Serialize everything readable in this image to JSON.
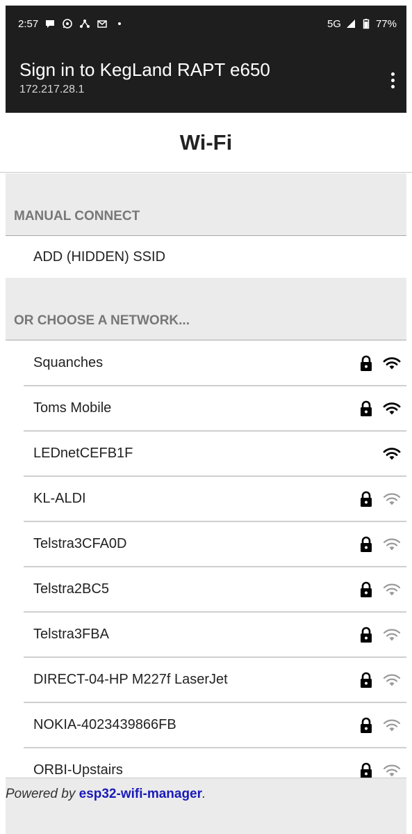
{
  "status_bar": {
    "time": "2:57",
    "left_icons": [
      "chat-bubble-icon",
      "whatsapp-icon",
      "network-share-icon",
      "gmail-icon",
      "dot-icon"
    ],
    "network_type": "5G",
    "battery": "77%"
  },
  "app_bar": {
    "title": "Sign in to KegLand RAPT e650",
    "subtitle": "172.217.28.1"
  },
  "page": {
    "heading": "Wi-Fi"
  },
  "manual_connect": {
    "header": "MANUAL CONNECT",
    "hidden_ssid_label": "ADD (HIDDEN) SSID"
  },
  "networks": {
    "header": "OR CHOOSE A NETWORK...",
    "items": [
      {
        "ssid": "Squanches",
        "locked": true,
        "signal": "strong"
      },
      {
        "ssid": "Toms Mobile",
        "locked": true,
        "signal": "strong"
      },
      {
        "ssid": "LEDnetCEFB1F",
        "locked": false,
        "signal": "strong"
      },
      {
        "ssid": "KL-ALDI",
        "locked": true,
        "signal": "weak"
      },
      {
        "ssid": "Telstra3CFA0D",
        "locked": true,
        "signal": "weak"
      },
      {
        "ssid": "Telstra2BC5",
        "locked": true,
        "signal": "weak"
      },
      {
        "ssid": "Telstra3FBA",
        "locked": true,
        "signal": "weak"
      },
      {
        "ssid": "DIRECT-04-HP M227f LaserJet",
        "locked": true,
        "signal": "weak"
      },
      {
        "ssid": "NOKIA-4023439866FB",
        "locked": true,
        "signal": "weak"
      },
      {
        "ssid": "ORBI-Upstairs",
        "locked": true,
        "signal": "weak"
      }
    ]
  },
  "footer": {
    "prefix": "Powered by ",
    "link_text": "esp32-wifi-manager",
    "suffix": "."
  },
  "colors": {
    "bar_background": "#1e1e1e",
    "section_background": "#ebebeb",
    "link": "#1a1ab8",
    "signal_strong": "#000000",
    "signal_weak": "#9a9a9a"
  }
}
